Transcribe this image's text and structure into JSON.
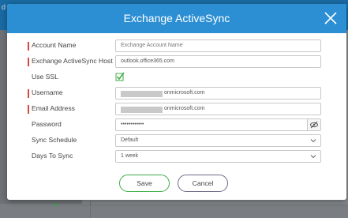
{
  "background": {
    "corner_text": "d"
  },
  "dialog": {
    "title": "Exchange ActiveSync",
    "fields": {
      "account_name": {
        "label": "Account Name",
        "placeholder": "Exchange Account Name",
        "required": true
      },
      "host": {
        "label": "Exchange ActiveSync Host",
        "value": "outlook.office365.com",
        "required": true
      },
      "use_ssl": {
        "label": "Use SSL",
        "checked": true
      },
      "username": {
        "label": "Username",
        "value_suffix": "onmicrosoft.com",
        "required": true
      },
      "email": {
        "label": "Email Address",
        "value_suffix": "onmicrosoft.com",
        "required": true
      },
      "password": {
        "label": "Password",
        "value": "••••••••••••"
      },
      "sync_schedule": {
        "label": "Sync Schedule",
        "value": "Default"
      },
      "days_to_sync": {
        "label": "Days To Sync",
        "value": "1 week"
      }
    },
    "buttons": {
      "save": "Save",
      "cancel": "Cancel"
    },
    "colors": {
      "header": "#2d8fd3",
      "required_marker": "#e0433f",
      "save_border": "#3fae49",
      "cancel_border": "#6c6c86",
      "check": "#3fae49"
    }
  }
}
